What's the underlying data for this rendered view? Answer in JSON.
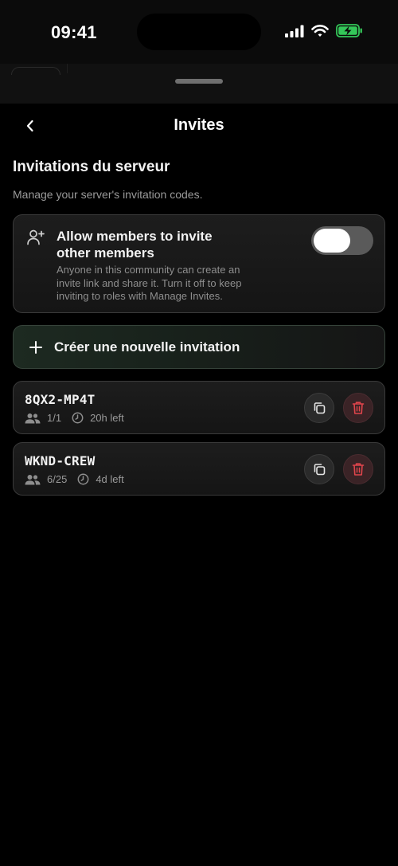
{
  "status_bar": {
    "time": "09:41"
  },
  "nav": {
    "title": "Invites"
  },
  "section": {
    "title": "Invitations du serveur",
    "subtitle": "Manage your server's invitation codes."
  },
  "allow_members": {
    "title_line1": "Allow members to invite",
    "title_line2": "other members",
    "description_line1": "Anyone in this community can create an",
    "description_line2": "invite link and share it. Turn it off to keep",
    "description_line3": "inviting to roles with Manage Invites.",
    "enabled": true
  },
  "create_invite": {
    "label": "Créer une nouvelle invitation"
  },
  "invites": [
    {
      "code": "8QX2-MP4T",
      "uses": "1/1",
      "expires": "20h left"
    },
    {
      "code": "WKND-CREW",
      "uses": "6/25",
      "expires": "4d left"
    }
  ],
  "colors": {
    "background": "#000000",
    "delete_icon": "#e0454c",
    "toggle_on": "#5a5a5a",
    "battery": "#34c759"
  },
  "icons": {
    "back": "chevron-left-icon",
    "allow": "user-plus-icon",
    "create": "plus-icon",
    "uses": "people-icon",
    "expires": "clock-icon",
    "copy": "copy-icon",
    "delete": "trash-icon"
  }
}
